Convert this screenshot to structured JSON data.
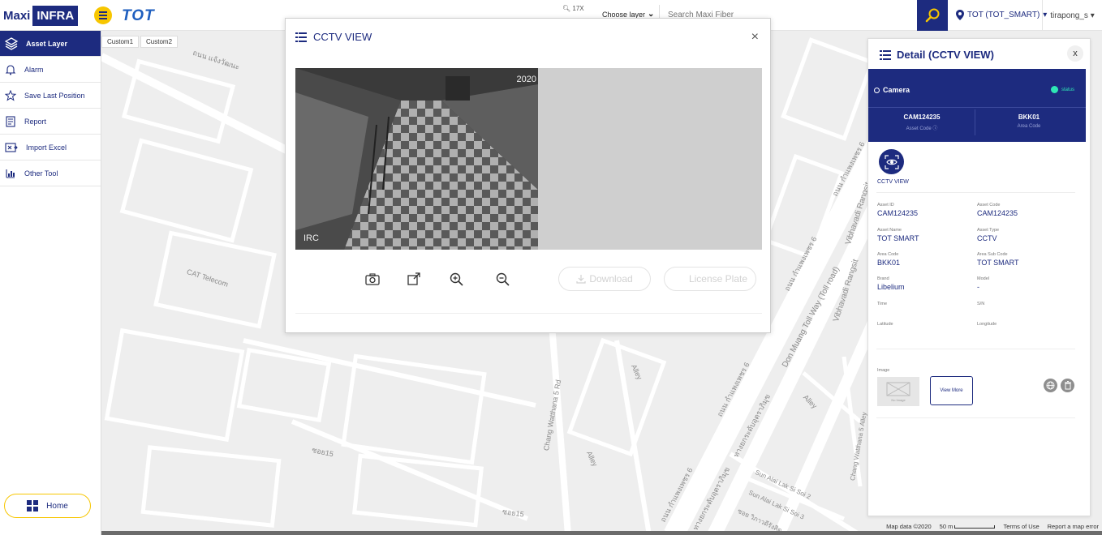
{
  "header": {
    "brand_maxi": "Maxi",
    "brand_infra": "INFRA",
    "tot_logo": "TOT",
    "zoom": "17X",
    "layer_select": "Choose layer",
    "search_placeholder": "Search Maxi Fiber",
    "org": "TOT (TOT_SMART)",
    "user": "tirapong_s"
  },
  "sidebar": {
    "items": [
      {
        "label": "Asset Layer",
        "icon": "layers-icon"
      },
      {
        "label": "Alarm",
        "icon": "bell-icon"
      },
      {
        "label": "Save Last Position",
        "icon": "pin-star-icon"
      },
      {
        "label": "Report",
        "icon": "report-icon"
      },
      {
        "label": "Import Excel",
        "icon": "excel-icon"
      },
      {
        "label": "Other Tool",
        "icon": "tool-icon"
      }
    ],
    "home": "Home"
  },
  "custom_tabs": [
    "Custom1",
    "Custom2"
  ],
  "cctv": {
    "title": "CCTV VIEW",
    "close": "×",
    "timestamp": "2020",
    "cam_label": "IRC",
    "download": "Download",
    "license_plate": "License Plate"
  },
  "detail": {
    "title": "Detail (CCTV VIEW)",
    "close": "x",
    "camera_type": "Camera",
    "status": "status",
    "asset_code_val": "CAM124235",
    "asset_code_lbl": "Asset Code",
    "area_code_val": "BKK01",
    "area_code_lbl": "Area Code",
    "view_label": "CCTV VIEW",
    "fields": [
      {
        "label": "Asset ID",
        "value": "CAM124235"
      },
      {
        "label": "Asset Code",
        "value": "CAM124235"
      },
      {
        "label": "Asset Name",
        "value": "TOT SMART"
      },
      {
        "label": "Asset Type",
        "value": "CCTV"
      },
      {
        "label": "Area Code",
        "value": "BKK01"
      },
      {
        "label": "Area Sub Code",
        "value": "TOT SMART"
      },
      {
        "label": "Brand",
        "value": "Libelium"
      },
      {
        "label": "Model",
        "value": "-"
      },
      {
        "label": "Time",
        "value": ""
      },
      {
        "label": "S/N",
        "value": ""
      },
      {
        "label": "Latitude",
        "value": ""
      },
      {
        "label": "Longitude",
        "value": ""
      }
    ],
    "image_label": "Image",
    "image_placeholder": "No Image",
    "view_more": "View More"
  },
  "map": {
    "labels": [
      "ถนน แจ้งวัฒนะ",
      "CAT Telecom",
      "Chang Watthana 5 Rd",
      "ซอย15",
      "ซอย15",
      "Alley",
      "Alley",
      "Alley",
      "ถนน กำแพงเพชร 6",
      "ถนน กำแพงเพชร 6",
      "ถนน กำแพงเพชร 6",
      "ถนน กำแพงเพชร 6",
      "ทางยกระดับอุตราภิมุข",
      "ทางยกระดับอุตราภิมุข",
      "Don Muang Toll Way (Toll road)",
      "Vibhavadi Rangsit",
      "Vibhavadi Rangsit",
      "Chang Watthana 5 Alley",
      "Sun Alai Lak Si Soi 2",
      "Sun Alai Lak Si Soi 3",
      "ซอย วิภาวดีรังสิต"
    ],
    "footer_data": "Map data ©2020",
    "footer_scale": "50 m",
    "footer_terms": "Terms of Use",
    "footer_report": "Report a map error"
  },
  "colors": {
    "brand_navy": "#1d2b7f",
    "brand_yellow": "#f7c600",
    "status_green": "#2ee7b5"
  }
}
